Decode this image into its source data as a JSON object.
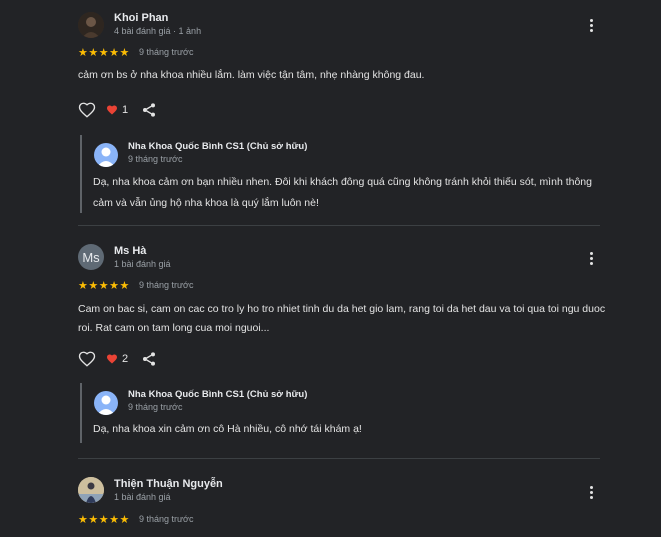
{
  "reviews": [
    {
      "author": "Khoi Phan",
      "meta": "4 bài đánh giá · 1 ảnh",
      "stars": "★★★★★",
      "rating": 5,
      "time": "9 tháng trước",
      "text": "cảm ơn bs ở nha khoa nhiều lắm. làm việc tận tâm, nhẹ nhàng không đau.",
      "likes": "1",
      "reply": {
        "owner": "Nha Khoa Quốc Bình CS1 (Chủ sở hữu)",
        "time": "9 tháng trước",
        "text": "Dạ, nha khoa cảm ơn bạn nhiều nhen. Đôi khi khách đông quá cũng không tránh khỏi thiếu sót, mình thông cảm và vẫn ủng hộ nha khoa là quý lắm luôn nè!"
      }
    },
    {
      "author": "Ms Hà",
      "initials": "Ms",
      "meta": "1 bài đánh giá",
      "stars": "★★★★★",
      "rating": 5,
      "time": "9 tháng trước",
      "text": "Cam on bac si, cam on cac co tro ly ho tro nhiet tinh du da het gio lam, rang toi da het dau va toi qua toi ngu duoc roi. Rat cam on tam long cua moi nguoi...",
      "likes": "2",
      "reply": {
        "owner": "Nha Khoa Quốc Bình CS1 (Chủ sở hữu)",
        "time": "9 tháng trước",
        "text": "Dạ, nha khoa xin cảm ơn cô Hà nhiều, cô nhớ tái khám ạ!"
      }
    },
    {
      "author": "Thiện Thuận Nguyễn",
      "meta": "1 bài đánh giá",
      "stars": "★★★★★",
      "rating": 5,
      "time": "9 tháng trước"
    }
  ],
  "icons": {
    "more": "more-vert-icon",
    "heart": "heart-outline-icon",
    "like": "heart-filled-icon",
    "share": "share-icon"
  },
  "colors": {
    "background": "#222326",
    "star": "#fbbc04",
    "like_heart": "#ea4335",
    "owner_avatar": "#8ab4f8"
  }
}
